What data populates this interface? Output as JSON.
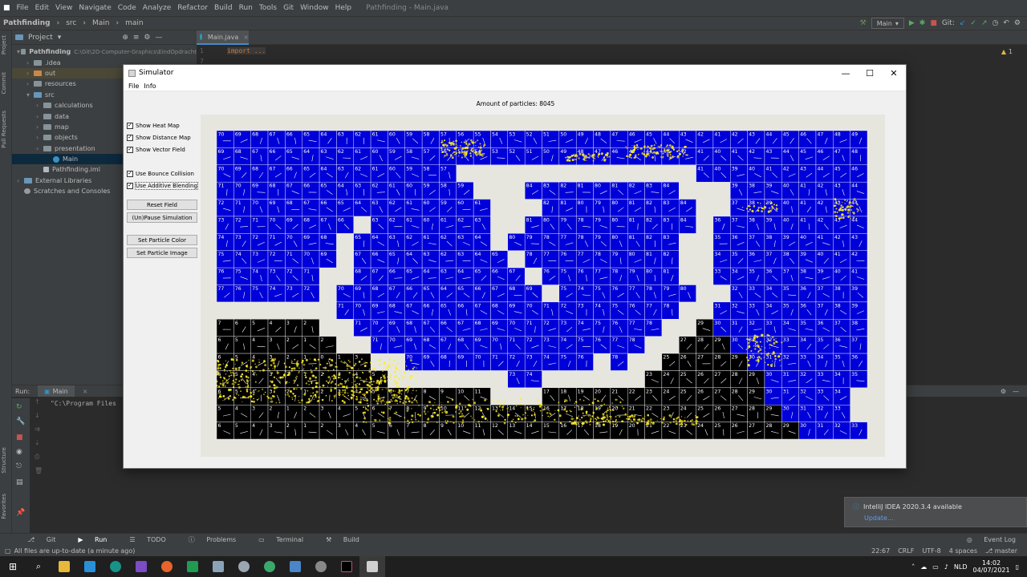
{
  "ide": {
    "menu": [
      "File",
      "Edit",
      "View",
      "Navigate",
      "Code",
      "Analyze",
      "Refactor",
      "Build",
      "Run",
      "Tools",
      "Git",
      "Window",
      "Help"
    ],
    "window_title": "Pathfinding - Main.java",
    "breadcrumb": [
      "Pathfinding",
      "src",
      "Main",
      "main"
    ],
    "run_config": "Main",
    "git_label": "Git:",
    "project_label": "Project",
    "left_strip": [
      "Project",
      "Commit",
      "Pull Requests",
      "Structure",
      "Favorites"
    ],
    "tree": [
      {
        "label": "Pathfinding",
        "extra": "C:\\Git\\2D-Computer-Graphics\\EindOpdracht",
        "indent": 0,
        "icon": "folder"
      },
      {
        "label": ".idea",
        "indent": 1,
        "icon": "folder"
      },
      {
        "label": "out",
        "indent": 1,
        "icon": "folder-orange"
      },
      {
        "label": "resources",
        "indent": 1,
        "icon": "folder"
      },
      {
        "label": "src",
        "indent": 1,
        "icon": "folder-blue"
      },
      {
        "label": "calculations",
        "indent": 2,
        "icon": "folder"
      },
      {
        "label": "data",
        "indent": 2,
        "icon": "folder"
      },
      {
        "label": "map",
        "indent": 2,
        "icon": "folder"
      },
      {
        "label": "objects",
        "indent": 2,
        "icon": "folder"
      },
      {
        "label": "presentation",
        "indent": 2,
        "icon": "folder"
      },
      {
        "label": "Main",
        "indent": 3,
        "icon": "java"
      },
      {
        "label": "Pathfinding.iml",
        "indent": 2,
        "icon": "file"
      },
      {
        "label": "External Libraries",
        "indent": 0,
        "icon": "lib"
      },
      {
        "label": "Scratches and Consoles",
        "indent": 0,
        "icon": "scratch"
      }
    ],
    "editor_tab": "Main.java",
    "editor_lines": [
      "1",
      "7"
    ],
    "editor_code": "import ...",
    "warning_count": "1",
    "run_label": "Run:",
    "run_tab": "Main",
    "console_text": "\"C:\\Program Files",
    "bottom_tabs": [
      "Git",
      "Run",
      "TODO",
      "Problems",
      "Terminal",
      "Build"
    ],
    "event_log": "Event Log",
    "status_left": "All files are up-to-date (a minute ago)",
    "status_right": [
      "22:67",
      "CRLF",
      "UTF-8",
      "4 spaces",
      "master"
    ],
    "notification_title": "IntelliJ IDEA 2020.3.4 available",
    "notification_link": "Update...",
    "tray_lang": "NLD",
    "tray_time": "14:02",
    "tray_date": "04/07/2021"
  },
  "simulator": {
    "title": "Simulator",
    "menu": [
      "File",
      "Info"
    ],
    "particle_label": "Amount of particles: 8045",
    "checkboxes": [
      {
        "label": "Show Heat Map",
        "checked": true
      },
      {
        "label": "Show Distance Map",
        "checked": true
      },
      {
        "label": "Show Vector Field",
        "checked": true
      },
      {
        "label": "Use Bounce Collision",
        "checked": true
      },
      {
        "label": "Use Additive Blending",
        "checked": true
      }
    ],
    "buttons": [
      "Reset Field",
      "(Un)Pause Simulation",
      "Set Particle Color",
      "Set Particle Image"
    ],
    "colors": {
      "cell": "#0000d8",
      "cold": "#000000",
      "wall": "#e6e6df",
      "particle": "#ffee22"
    },
    "rows": [
      "70 69 68 67 66 65 64 63 62 61 60 59 58 57 56 55 54 53 52 51 50 49 48 47 46 45 44 43 42 41 42 43 44 45 46 47 48 49",
      "69 68 67 66 65 64 63 62 61 60 59 58 57 56 55 54 53 52 51 50 49 48 47 46 45 44 43 42 41 40 41 42 43 44 45 46 47 48",
      "70 69 68 67 66 65 64 63 62 61 60 59 58 57 # # # # # # # # # # # # # # 41 40 39 40 41 42 43 44 45 46 47",
      "71 70 69 68 67 66 65 64 63 62 61 60 59 58 59 # # # 84 83 82 81 80 81 82 83 84 # # # 39 38 39 40 41 42 43 44 45 46",
      "72 71 70 69 68 67 66 65 64 63 62 61 60 59 60 61 # # # 82 81 80 79 80 81 82 83 84 # # 37 38 39 40 41 42 43 44 45",
      "73 72 71 70 69 68 67 66 # 63 62 61 60 61 62 63 # # 81 80 79 78 79 80 81 82 83 84 # 36 37 38 39 40 41 42 43 44",
      "74 73 72 71 70 69 68 # 65 64 63 62 61 62 63 64 # 80 79 78 77 78 79 80 81 82 83 # # 35 36 37 38 39 40 41 42 43",
      "75 74 73 72 71 70 69 # 67 66 65 64 63 62 63 64 65 # 78 77 76 77 78 79 80 81 82 # # 34 35 36 37 38 39 40 41 42",
      "76 75 74 73 72 71 # # 68 67 66 65 64 63 64 65 66 67 # 76 75 76 77 78 79 80 81 # # 33 34 35 36 37 38 39 40 41",
      "77 76 75 74 73 72 # 70 69 68 67 66 65 64 65 66 67 68 69 # 75 74 75 76 77 78 79 80 # # 32 33 34 35 36 37 38 39 40",
      "# # # # # # # 71 70 69 68 67 66 65 66 67 68 69 70 71 72 73 74 75 76 77 78 # # 31 32 33 34 35 36 37 38 39",
      "7 6 5 4 3 2 # # 71 70 69 68 67 66 67 68 69 70 71 72 73 74 75 76 77 78 # # 29 30 31 32 33 34 35 36 37 38",
      "6 5 4 3 2 1 2 # # 71 70 69 68 67 68 69 70 71 72 73 74 75 76 77 78 # # 27 28 29 30 31 32 33 34 35 36 37",
      "6 5 4 3 2 1 0 1 3 # # 70 69 68 69 70 71 72 73 74 75 76 # 78 # # 25 26 27 28 29 30 31 32 33 34 35 36",
      "6 5 4 3 2 1 2 3 4 5 # # # # # # # 73 74 # # # # # # 23 24 25 26 27 28 29 30 31 32 33 34 35",
      "6 5 4 3 2 1 2 3 4 5 6 7 8 9 10 11 # # # 17 18 19 20 21 22 23 24 25 26 27 28 29 30 31 32 33 34",
      "5 4 3 2 1 2 3 4 5 6 7 8 9 10 11 12 13 14 15 16 17 18 19 20 21 22 23 24 25 26 27 28 29 30 31 32 33",
      "6 5 4 3 2 1 2 3 4 5 6 7 8 9 10 11 12 13 14 15 16 17 18 19 20 21 22 23 24 25 26 27 28 29 30 31 32 33 34"
    ]
  }
}
